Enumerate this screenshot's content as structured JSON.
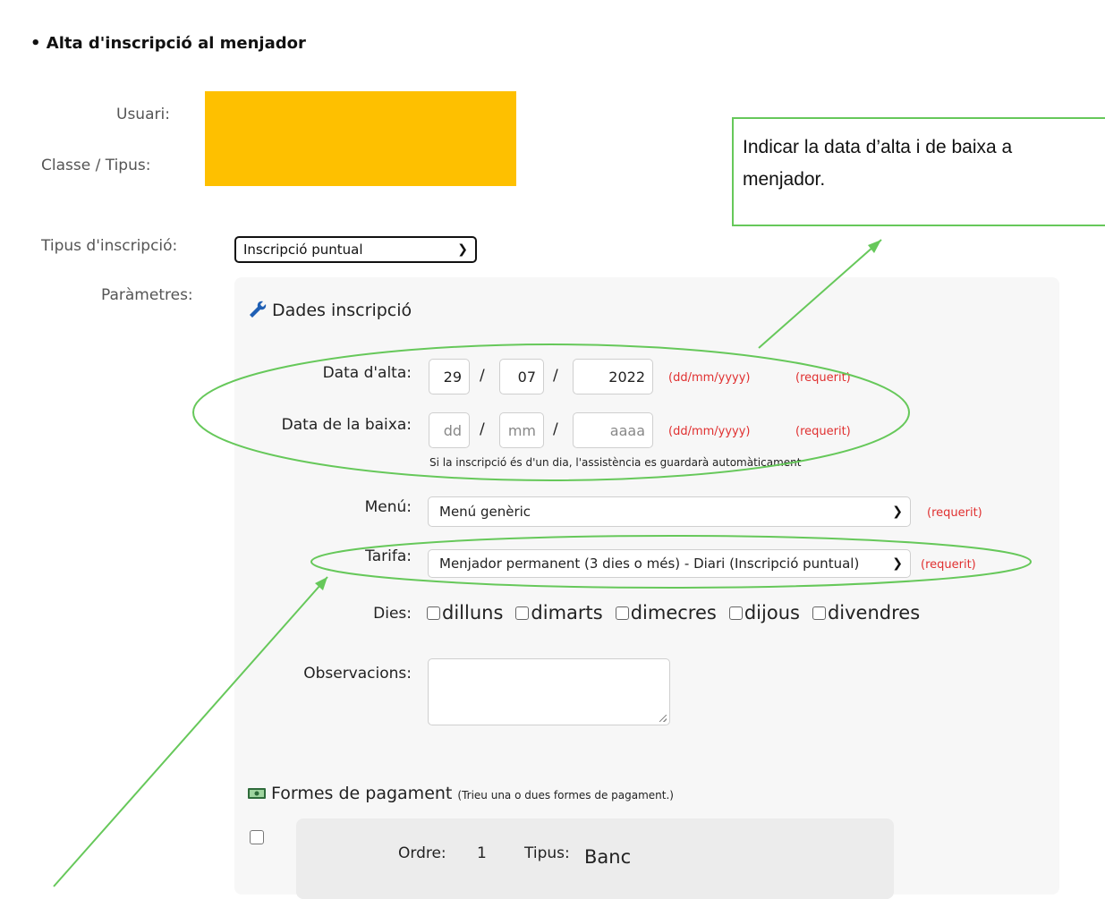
{
  "page_title": "Alta d'inscripció al menjador",
  "labels": {
    "usuari": "Usuari:",
    "classe": "Classe / Tipus:",
    "tipus_inscripcio": "Tipus d'inscripció:",
    "parametres": "Paràmetres:"
  },
  "tipus_inscripcio_value": "Inscripció puntual",
  "callout": {
    "line1": "Indicar la data d’alta i de baixa a",
    "line2": "menjador."
  },
  "panel": {
    "header": "Dades inscripció",
    "data_alta": {
      "label": "Data d'alta:",
      "dd": "29",
      "mm": "07",
      "yyyy": "2022",
      "format": "(dd/mm/yyyy)",
      "required": "(requerit)"
    },
    "data_baixa": {
      "label": "Data de la baixa:",
      "dd_placeholder": "dd",
      "mm_placeholder": "mm",
      "yyyy_placeholder": "aaaa",
      "format": "(dd/mm/yyyy)",
      "required": "(requerit)"
    },
    "hint": "Si la inscripció és d'un dia, l'assistència es guardarà automàticament",
    "menu": {
      "label": "Menú:",
      "value": "Menú genèric",
      "required": "(requerit)"
    },
    "tarifa": {
      "label": "Tarifa:",
      "value": "Menjador permanent (3 dies o més) - Diari (Inscripció puntual)",
      "required": "(requerit)"
    },
    "dies": {
      "label": "Dies:",
      "items": [
        "dilluns",
        "dimarts",
        "dimecres",
        "dijous",
        "divendres"
      ]
    },
    "observacions": {
      "label": "Observacions:"
    },
    "formes_pagament": {
      "title": "Formes de pagament",
      "note": "(Trieu una o dues formes de pagament.)"
    },
    "pagament_1": {
      "ordre_label": "Ordre:",
      "ordre_value": "1",
      "tipus_label": "Tipus:",
      "tipus_value": "Banc"
    }
  },
  "colors": {
    "annotation_green": "#66c85a",
    "redaction": "#fec000",
    "required_red": "#e03030"
  },
  "icons": [
    "wrench-icon",
    "money-icon",
    "chevron-down-icon"
  ]
}
